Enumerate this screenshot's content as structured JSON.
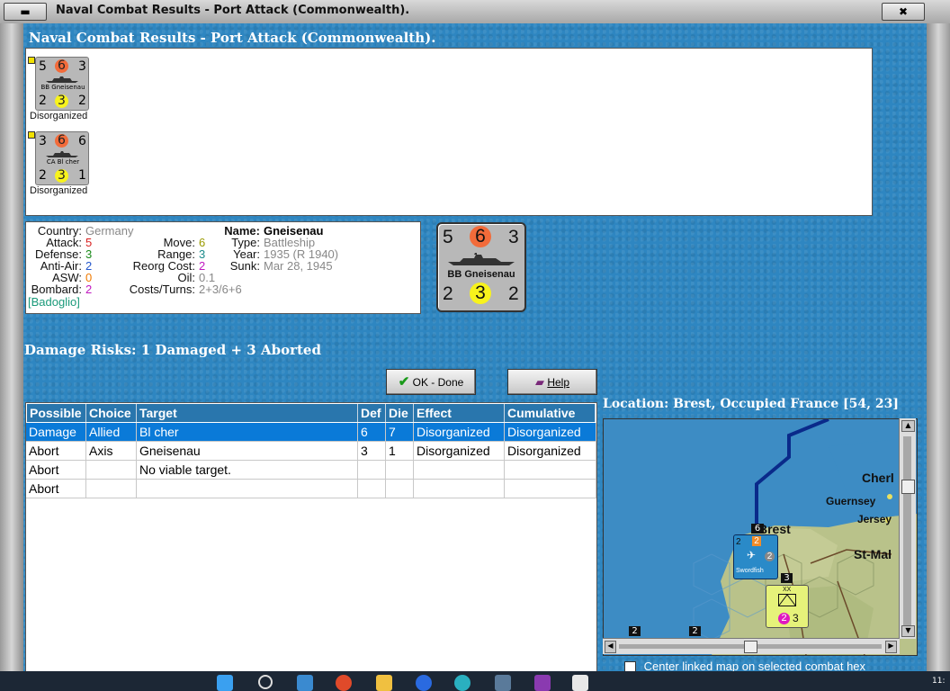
{
  "window": {
    "title": "Naval Combat Results - Port Attack (Commonwealth).",
    "sys_button": "▬",
    "close_button": "✖"
  },
  "dialog": {
    "title": "Naval Combat Results - Port Attack (Commonwealth)."
  },
  "units": [
    {
      "top_left": "5",
      "top_mid": "6",
      "top_right": "3",
      "name": "BB Gneisenau",
      "bot_left": "2",
      "bot_mid": "3",
      "bot_right": "2",
      "status": "Disorganized"
    },
    {
      "top_left": "3",
      "top_mid": "6",
      "top_right": "6",
      "name": "CA Bl cher",
      "bot_left": "2",
      "bot_mid": "3",
      "bot_right": "1",
      "status": "Disorganized"
    }
  ],
  "info": {
    "country_label": "Country:",
    "country": "Germany",
    "attack_label": "Attack:",
    "attack": "5",
    "defense_label": "Defense:",
    "defense": "3",
    "antiair_label": "Anti-Air:",
    "antiair": "2",
    "asw_label": "ASW:",
    "asw": "0",
    "bombard_label": "Bombard:",
    "bombard": "2",
    "extra": "[Badoglio]",
    "move_label": "Move:",
    "move": "6",
    "range_label": "Range:",
    "range": "3",
    "reorg_label": "Reorg Cost:",
    "reorg": "2",
    "oil_label": "Oil:",
    "oil": "0.1",
    "costs_label": "Costs/Turns:",
    "costs": "2+3/6+6",
    "name_label": "Name:",
    "name": "Gneisenau",
    "type_label": "Type:",
    "type": "Battleship",
    "year_label": "Year:",
    "year": "1935 (R 1940)",
    "sunk_label": "Sunk:",
    "sunk": "Mar 28, 1945"
  },
  "big_counter": {
    "top_left": "5",
    "top_mid": "6",
    "top_right": "3",
    "name": "BB Gneisenau",
    "bot_left": "2",
    "bot_mid": "3",
    "bot_right": "2"
  },
  "damage_risks": "Damage Risks:  1 Damaged + 3 Aborted",
  "buttons": {
    "ok": "OK - Done",
    "help": "Help"
  },
  "table": {
    "headers": [
      "Possible",
      "Choice",
      "Target",
      "Def",
      "Die",
      "Effect",
      "Cumulative"
    ],
    "rows": [
      [
        "Damage",
        "Allied",
        "Bl cher",
        "6",
        "7",
        "Disorganized",
        "Disorganized"
      ],
      [
        "Abort",
        "Axis",
        "Gneisenau",
        "3",
        "1",
        "Disorganized",
        "Disorganized"
      ],
      [
        "Abort",
        "",
        "No viable target.",
        "",
        "",
        "",
        ""
      ],
      [
        "Abort",
        "",
        "",
        "",
        "",
        "",
        ""
      ]
    ],
    "selected_row": 0
  },
  "location": "Location:  Brest, Occupied France [54, 23]",
  "map": {
    "labels": {
      "cherbourg": "Cherl",
      "guernsey": "Guernsey",
      "jersey": "Jersey",
      "brest": "Brest",
      "stmalo": "St-Mal"
    },
    "counter1": {
      "top": "6",
      "a": "2",
      "b": "2",
      "c": "2",
      "name": "Swordfish"
    },
    "counter2": {
      "top": "3",
      "size": "XX",
      "strength": "2",
      "move": "3"
    },
    "stack_counts": [
      "2",
      "2"
    ]
  },
  "center_check": "Center linked map on selected combat hex",
  "taskbar": {
    "clock": "11:"
  },
  "colors": {
    "attack": "#d81f1f",
    "defense": "#1a8a1a",
    "accent": "#2976ad"
  }
}
